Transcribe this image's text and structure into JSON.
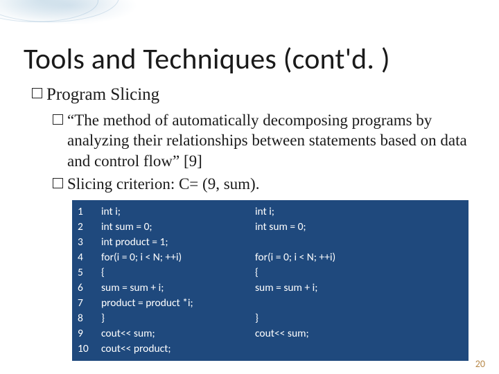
{
  "title": "Tools and Techniques (cont'd. )",
  "bullets": {
    "main": "Program Slicing",
    "sub_quote": "“The method of automatically decomposing programs by analyzing their relationships between statements based on data and control flow” [9]",
    "sub_criterion": "Slicing criterion: C= (9, sum)."
  },
  "code": {
    "line_numbers": "1\n2\n3\n4\n5\n6\n7\n8\n9\n10",
    "original": "int i;\nint sum = 0;\nint product = 1;\nfor(i = 0; i < N; ++i)\n{\nsum = sum + i;\nproduct = product *i;\n}\ncout<< sum;\ncout<< product;",
    "sliced": "int i;\nint sum = 0;\n\nfor(i = 0; i < N; ++i)\n{\nsum = sum + i;\n\n}\ncout<< sum;\n"
  },
  "page_number": "20"
}
